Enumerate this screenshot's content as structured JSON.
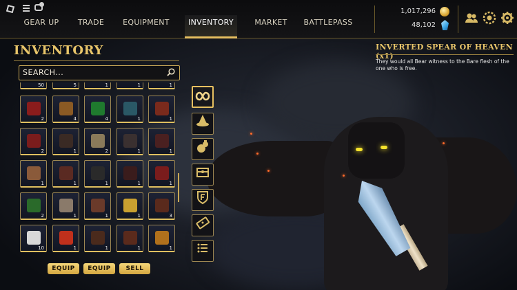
{
  "topbar": {
    "tabs": [
      "GEAR UP",
      "TRADE",
      "EQUIPMENT",
      "INVENTORY",
      "MARKET",
      "BATTLEPASS"
    ],
    "active_tab": "INVENTORY",
    "gold": "1,017,296",
    "gems": "48,102"
  },
  "inventory": {
    "title": "INVENTORY",
    "search_placeholder": "SEARCH...",
    "partial_row_counts": [
      "50",
      "5",
      "1",
      "1",
      "1"
    ],
    "rows": [
      [
        {
          "count": "2",
          "color": "#8a1c1c"
        },
        {
          "count": "4",
          "color": "#8a5a24"
        },
        {
          "count": "4",
          "color": "#1f7a2e"
        },
        {
          "count": "1",
          "color": "#2a5866"
        },
        {
          "count": "1",
          "color": "#7a2a1c"
        }
      ],
      [
        {
          "count": "2",
          "color": "#7a1c1c"
        },
        {
          "count": "1",
          "color": "#3a2a24"
        },
        {
          "count": "2",
          "color": "#8a7a5a"
        },
        {
          "count": "1",
          "color": "#3a3030"
        },
        {
          "count": "1",
          "color": "#4a2020"
        }
      ],
      [
        {
          "count": "1",
          "color": "#8a5a3a"
        },
        {
          "count": "1",
          "color": "#5a2a22"
        },
        {
          "count": "1",
          "color": "#2a2a2a"
        },
        {
          "count": "1",
          "color": "#3a1c1c"
        },
        {
          "count": "1",
          "color": "#7a1c1c"
        }
      ],
      [
        {
          "count": "2",
          "color": "#2a6a2a"
        },
        {
          "count": "1",
          "color": "#8a7a6a"
        },
        {
          "count": "1",
          "color": "#6a3a2a"
        },
        {
          "count": "1",
          "color": "#c9a030"
        },
        {
          "count": "3",
          "color": "#5a2a1c"
        }
      ],
      [
        {
          "count": "10",
          "color": "#d8d8d8"
        },
        {
          "count": "1",
          "color": "#c0301c"
        },
        {
          "count": "1",
          "color": "#4a2a1c"
        },
        {
          "count": "1",
          "color": "#5a2a1c"
        },
        {
          "count": "1",
          "color": "#b0701c"
        }
      ]
    ],
    "buttons": [
      "EQUIP",
      "EQUIP",
      "SELL"
    ]
  },
  "categories": [
    "infinity-icon",
    "wizard-hat-icon",
    "potion-icon",
    "chest-icon",
    "shield-icon",
    "ticket-icon",
    "list-icon"
  ],
  "detail": {
    "title": "INVERTED SPEAR OF HEAVEN (x1)",
    "description": "They would all Bear witness to the Bare flesh of the one who is free."
  },
  "colors": {
    "accent_gold": "#e8c56a",
    "slot_bg": "#1d2234",
    "button_gold": "#f5d77a"
  }
}
